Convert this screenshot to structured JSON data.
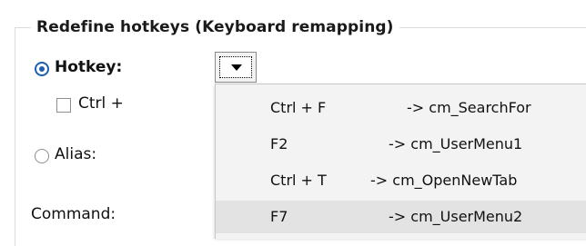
{
  "groupbox": {
    "title": "Redefine hotkeys (Keyboard remapping)"
  },
  "hotkey_radio": {
    "label": "Hotkey:",
    "checked": true
  },
  "ctrl_checkbox": {
    "label": "Ctrl +",
    "checked": false
  },
  "alias_radio": {
    "label": "Alias:",
    "checked": false
  },
  "command_label": "Command:",
  "dropdown": {
    "icon": "chevron-down-icon"
  },
  "popup_items": [
    {
      "key": "Ctrl + F",
      "command": "->  cm_SearchFor",
      "highlighted": false
    },
    {
      "key": "F2",
      "command": "->  cm_UserMenu1",
      "highlighted": false
    },
    {
      "key": "Ctrl + T",
      "command": "->  cm_OpenNewTab",
      "highlighted": false
    },
    {
      "key": "F7",
      "command": "->  cm_UserMenu2",
      "highlighted": true
    }
  ],
  "colors": {
    "radio_accent": "#1a5fb4",
    "popup_bg": "#f3f3f3",
    "highlight_bg": "#e3e3e3"
  }
}
